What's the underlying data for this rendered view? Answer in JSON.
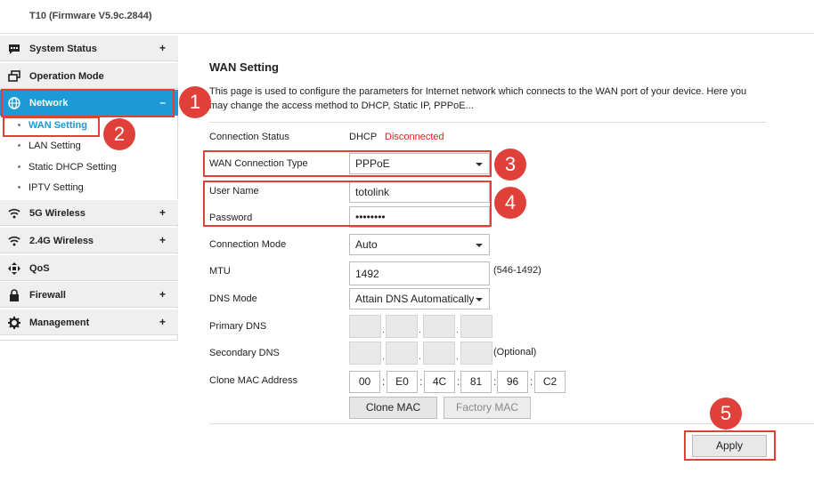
{
  "app": {
    "title": "T10 (Firmware V5.9c.2844)"
  },
  "sidebar": {
    "system_status": {
      "label": "System Status",
      "toggle": "+"
    },
    "operation_mode": {
      "label": "Operation Mode"
    },
    "network": {
      "label": "Network",
      "toggle": "–",
      "children": [
        "WAN Setting",
        "LAN Setting",
        "Static DHCP Setting",
        "IPTV Setting"
      ]
    },
    "wireless_5g": {
      "label": "5G Wireless",
      "toggle": "+"
    },
    "wireless_24g": {
      "label": "2.4G Wireless",
      "toggle": "+"
    },
    "qos": {
      "label": "QoS"
    },
    "firewall": {
      "label": "Firewall",
      "toggle": "+"
    },
    "management": {
      "label": "Management",
      "toggle": "+"
    }
  },
  "main": {
    "title": "WAN Setting",
    "description": "This page is used to configure the parameters for Internet network which connects to the WAN port of your device. Here you may change the access method to DHCP, Static IP, PPPoE...",
    "connection_status": {
      "label": "Connection Status",
      "mode": "DHCP",
      "state": "Disconnected"
    },
    "wan_type": {
      "label": "WAN Connection Type",
      "value": "PPPoE"
    },
    "username": {
      "label": "User Name",
      "value": "totolink"
    },
    "password": {
      "label": "Password",
      "value": "••••••••"
    },
    "connection_mode": {
      "label": "Connection Mode",
      "value": "Auto"
    },
    "mtu": {
      "label": "MTU",
      "value": "1492",
      "hint": "(546-1492)"
    },
    "dns_mode": {
      "label": "DNS Mode",
      "value": "Attain DNS Automatically"
    },
    "primary_dns": {
      "label": "Primary DNS",
      "separator": "."
    },
    "secondary_dns": {
      "label": "Secondary DNS",
      "hint": "(Optional)",
      "separator": "."
    },
    "clone_mac": {
      "label": "Clone MAC Address",
      "octets": [
        "00",
        "E0",
        "4C",
        "81",
        "96",
        "C2"
      ],
      "separator": ":"
    },
    "buttons": {
      "clone_mac": "Clone MAC",
      "factory_mac": "Factory MAC",
      "apply": "Apply"
    }
  },
  "annotations": [
    "1",
    "2",
    "3",
    "4",
    "5"
  ],
  "colors": {
    "accent": "#1d9ad6",
    "highlight": "#e0403a",
    "status_error": "#e02020"
  }
}
